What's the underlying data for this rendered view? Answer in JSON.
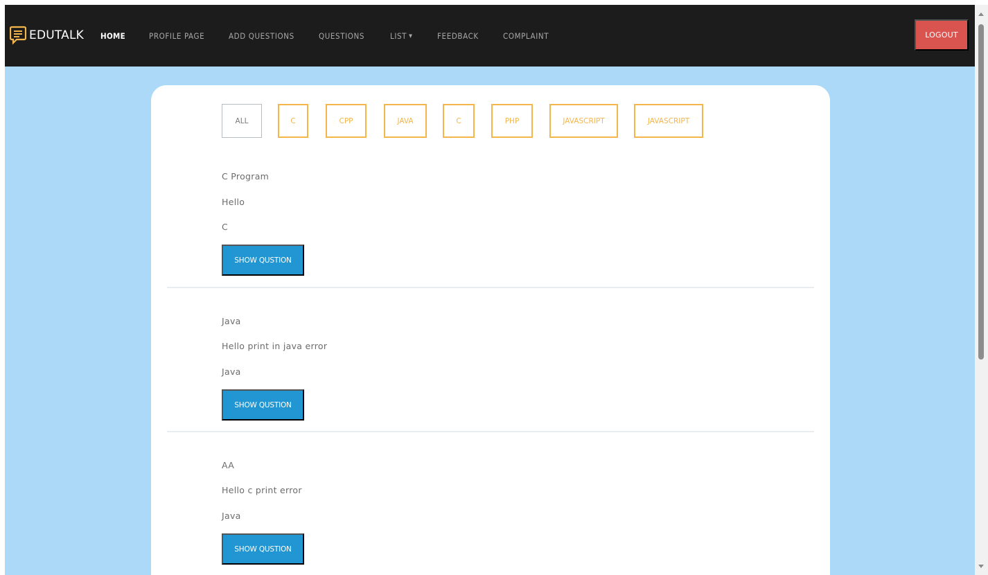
{
  "brand": {
    "name": "EDUTALK",
    "icon": "chat-bubble-icon"
  },
  "nav": {
    "items": [
      {
        "label": "HOME",
        "active": true
      },
      {
        "label": "PROFILE PAGE",
        "active": false
      },
      {
        "label": "ADD QUESTIONS",
        "active": false
      },
      {
        "label": "QUESTIONS",
        "active": false
      },
      {
        "label": "LIST",
        "active": false,
        "dropdown": true
      },
      {
        "label": "FEEDBACK",
        "active": false
      },
      {
        "label": "COMPLAINT",
        "active": false
      }
    ],
    "logout_label": "LOGOUT"
  },
  "filters": [
    "ALL",
    "C",
    "CPP",
    "JAVA",
    "C",
    "PHP",
    "JAVASCRIPT",
    "JAVASCRIPT"
  ],
  "questions": [
    {
      "title": "C Program",
      "body": "Hello",
      "language": "C",
      "button_label": "SHOW QUSTION"
    },
    {
      "title": "Java",
      "body": "Hello print in java error",
      "language": "Java",
      "button_label": "SHOW QUSTION"
    },
    {
      "title": "AA",
      "body": "Hello c print error",
      "language": "Java",
      "button_label": "SHOW QUSTION"
    }
  ],
  "colors": {
    "navbar_bg": "#1c1c1c",
    "page_bg": "#acd9f7",
    "brand_icon": "#f4b54a",
    "filter_border": "#f4b54a",
    "button_bg": "#2196d3",
    "logout_bg": "#d9534f"
  }
}
